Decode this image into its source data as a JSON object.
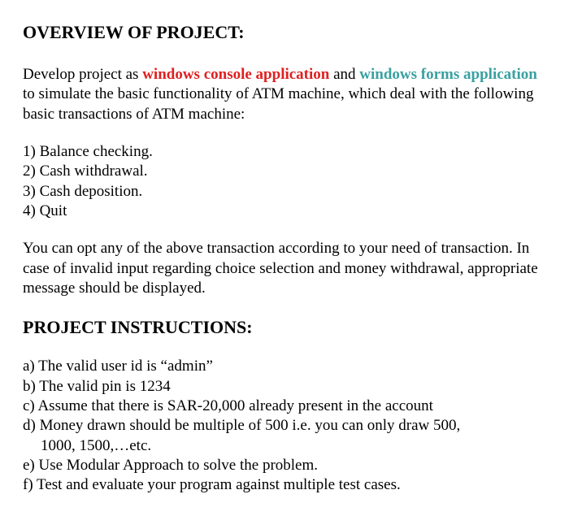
{
  "heading1": "OVERVIEW OF PROJECT:",
  "intro": {
    "part1": "Develop project as ",
    "red": "windows console application",
    "part2": " and ",
    "teal": "windows forms application",
    "part3": " to simulate the basic functionality of ATM machine, which deal with the following basic transactions of ATM machine:"
  },
  "transactions": {
    "item1": "1) Balance checking.",
    "item2": "2) Cash withdrawal.",
    "item3": "3) Cash deposition.",
    "item4": "4) Quit"
  },
  "para2": "You can opt any of the above transaction according to your need of transaction. In case of invalid input regarding choice selection and money withdrawal, appropriate message should be displayed.",
  "heading2": "PROJECT INSTRUCTIONS:",
  "instructions": {
    "a": "a) The valid user id is “admin”",
    "b": "b) The valid pin is 1234",
    "c": "c) Assume that there is SAR-20,000 already present in the account",
    "d": "d) Money drawn should be multiple of 500 i.e. you can only draw 500,",
    "d2": "1000, 1500,…etc.",
    "e": "e) Use Modular Approach to solve the problem.",
    "f": "f) Test and evaluate your program against multiple test cases."
  }
}
